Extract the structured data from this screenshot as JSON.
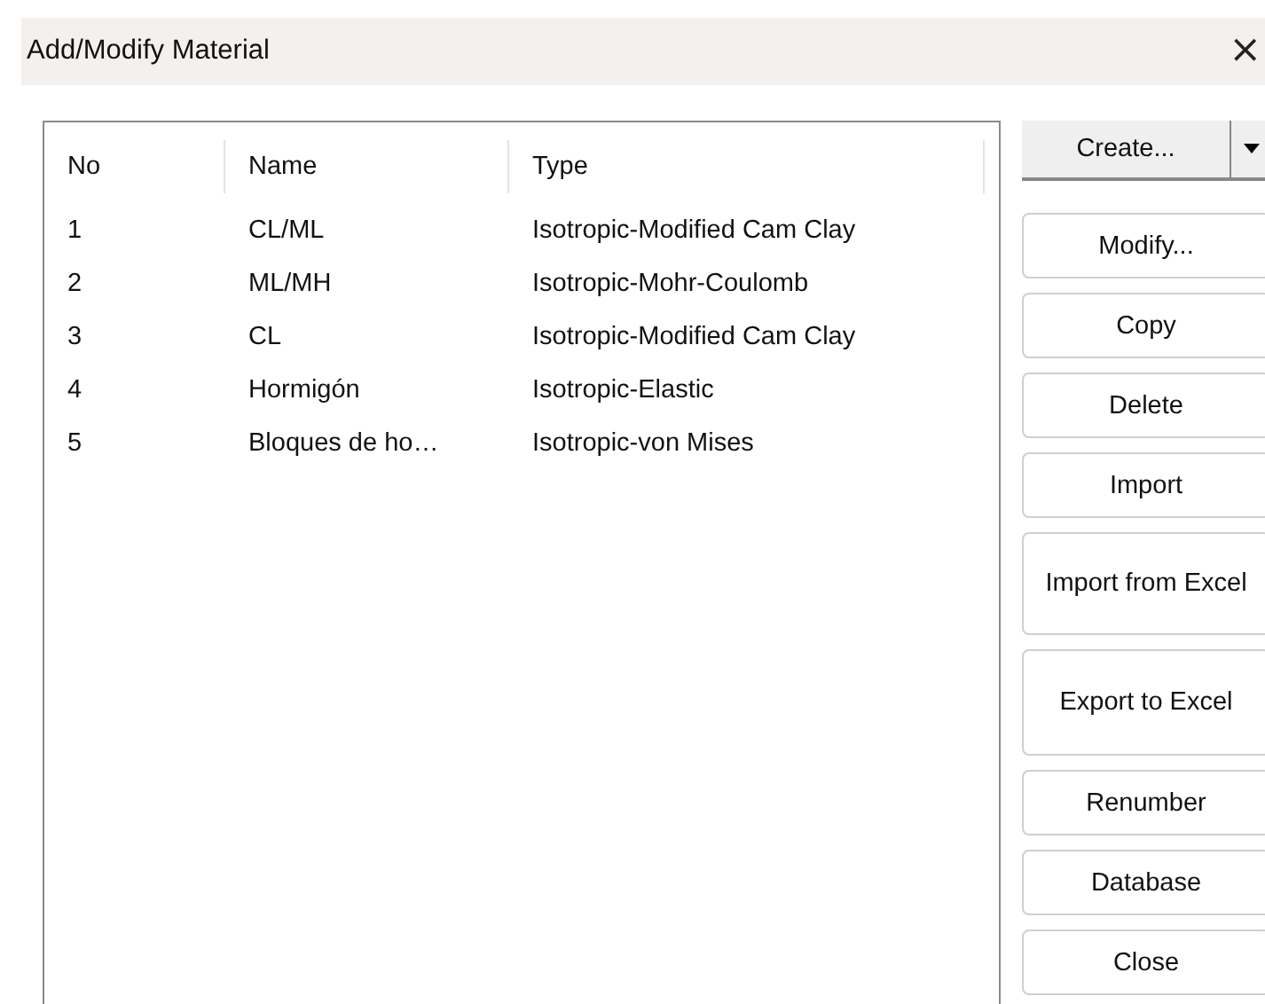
{
  "window": {
    "title": "Add/Modify Material",
    "close": "×"
  },
  "table": {
    "columns": [
      "No",
      "Name",
      "Type"
    ],
    "rows": [
      [
        "1",
        "CL/ML",
        "Isotropic-Modified Cam Clay"
      ],
      [
        "2",
        "ML/MH",
        "Isotropic-Mohr-Coulomb"
      ],
      [
        "3",
        "CL",
        "Isotropic-Modified Cam Clay"
      ],
      [
        "4",
        "Hormigón",
        "Isotropic-Elastic"
      ],
      [
        "5",
        "Bloques de ho…",
        "Isotropic-von Mises"
      ]
    ]
  },
  "buttons": [
    {
      "label": "Create...",
      "kind": "split"
    },
    {
      "label": "Modify...",
      "kind": "plain"
    },
    {
      "label": "Copy",
      "kind": "plain"
    },
    {
      "label": "Delete",
      "kind": "plain"
    },
    {
      "label": "Import",
      "kind": "plain"
    },
    {
      "label": "Import from Excel",
      "kind": "tall"
    },
    {
      "label": "Export to Excel",
      "kind": "tall"
    },
    {
      "label": "Renumber",
      "kind": "plain"
    },
    {
      "label": "Database",
      "kind": "plain"
    },
    {
      "label": "Close",
      "kind": "plain"
    }
  ]
}
